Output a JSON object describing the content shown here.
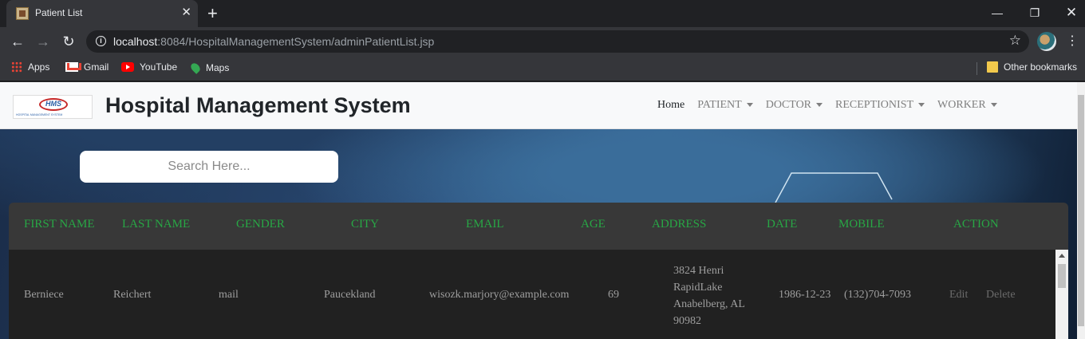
{
  "browser": {
    "tab_title": "Patient List",
    "url_host": "localhost",
    "url_rest": ":8084/HospitalManagementSystem/adminPatientList.jsp",
    "bookmarks": [
      "Apps",
      "Gmail",
      "YouTube",
      "Maps"
    ],
    "other_bookmarks": "Other bookmarks"
  },
  "site": {
    "logo_text": "HMS",
    "logo_sub": "HOSPITAL MANAGEMENT SYSTEM",
    "brand": "Hospital Management System",
    "nav": [
      "Home",
      "PATIENT",
      "DOCTOR",
      "RECEPTIONIST",
      "WORKER"
    ]
  },
  "search": {
    "placeholder": "Search Here..."
  },
  "table": {
    "headers": [
      "FIRST NAME",
      "LAST NAME",
      "GENDER",
      "CITY",
      "EMAIL",
      "AGE",
      "ADDRESS",
      "DATE",
      "MOBILE",
      "ACTION"
    ],
    "rows": [
      {
        "first_name": "Berniece",
        "last_name": "Reichert",
        "gender": "mail",
        "city": "Paucekland",
        "email": "wisozk.marjory@example.com",
        "age": "69",
        "address": "3824 Henri RapidLake Anabelberg, AL 90982",
        "date": "1986-12-23",
        "mobile": "(132)704-7093",
        "edit": "Edit",
        "delete": "Delete"
      }
    ]
  },
  "colors": {
    "header_text": "#28a745",
    "table_header_bg": "#383838",
    "table_body_bg": "#212121"
  }
}
